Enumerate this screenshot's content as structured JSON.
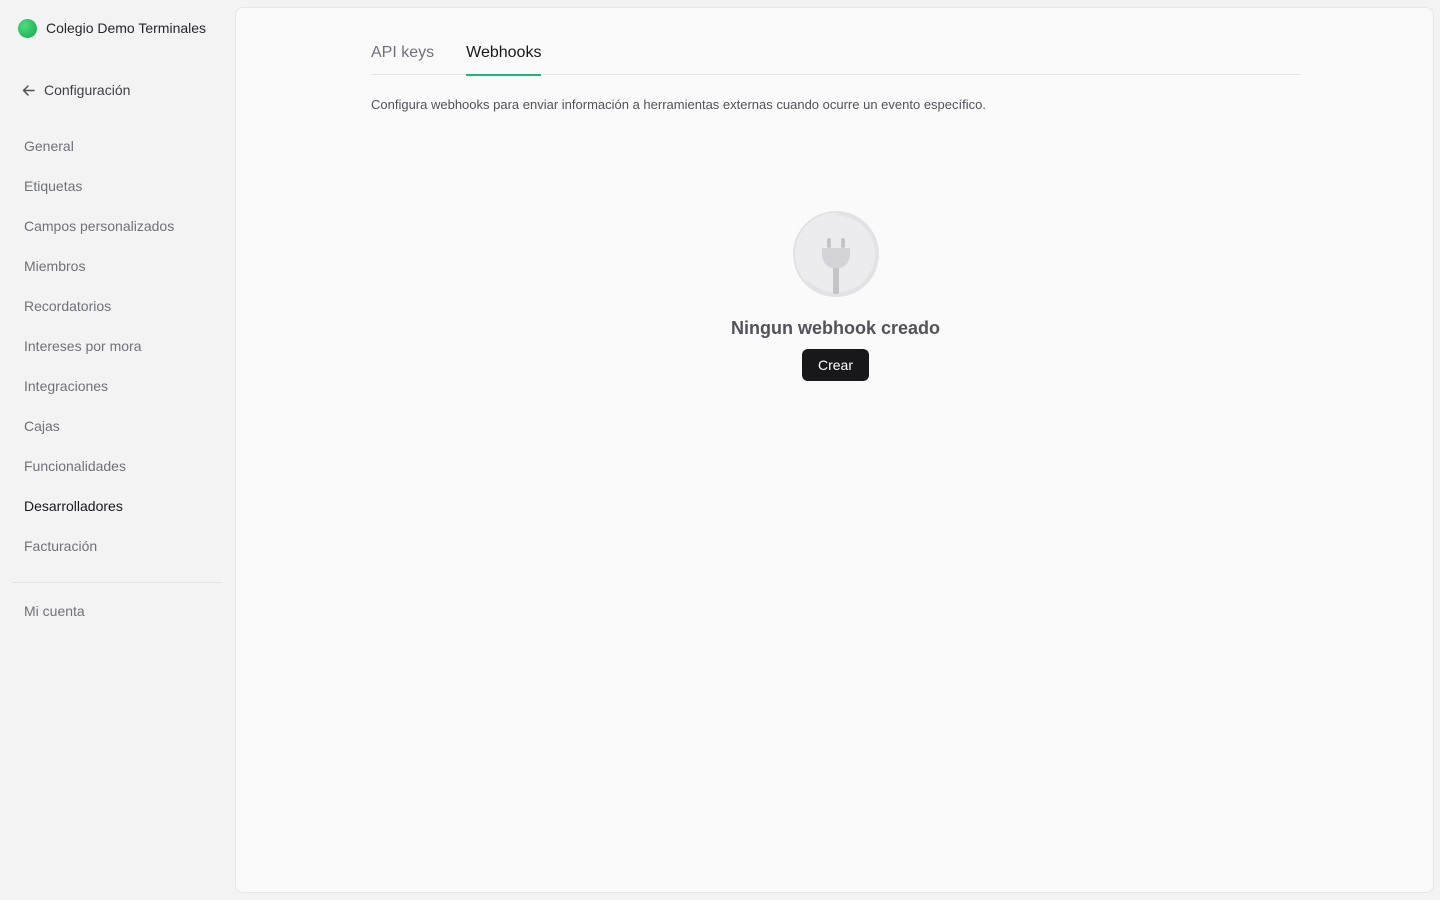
{
  "sidebar": {
    "workspace_name": "Colegio Demo Terminales",
    "back_label": "Configuración",
    "items": [
      {
        "label": "General"
      },
      {
        "label": "Etiquetas"
      },
      {
        "label": "Campos personalizados"
      },
      {
        "label": "Miembros"
      },
      {
        "label": "Recordatorios"
      },
      {
        "label": "Intereses por mora"
      },
      {
        "label": "Integraciones"
      },
      {
        "label": "Cajas"
      },
      {
        "label": "Funcionalidades"
      },
      {
        "label": "Desarrolladores"
      },
      {
        "label": "Facturación"
      }
    ],
    "active_item": "Desarrolladores",
    "account_label": "Mi cuenta"
  },
  "tabs": [
    {
      "label": "API keys"
    },
    {
      "label": "Webhooks"
    }
  ],
  "active_tab": "Webhooks",
  "description": "Configura webhooks para enviar información a herramientas externas cuando ocurre un evento específico.",
  "empty_state": {
    "icon": "plug-icon",
    "title": "Ningun webhook creado",
    "button_label": "Crear"
  },
  "colors": {
    "accent": "#22b573",
    "primary_button": "#18181b"
  }
}
